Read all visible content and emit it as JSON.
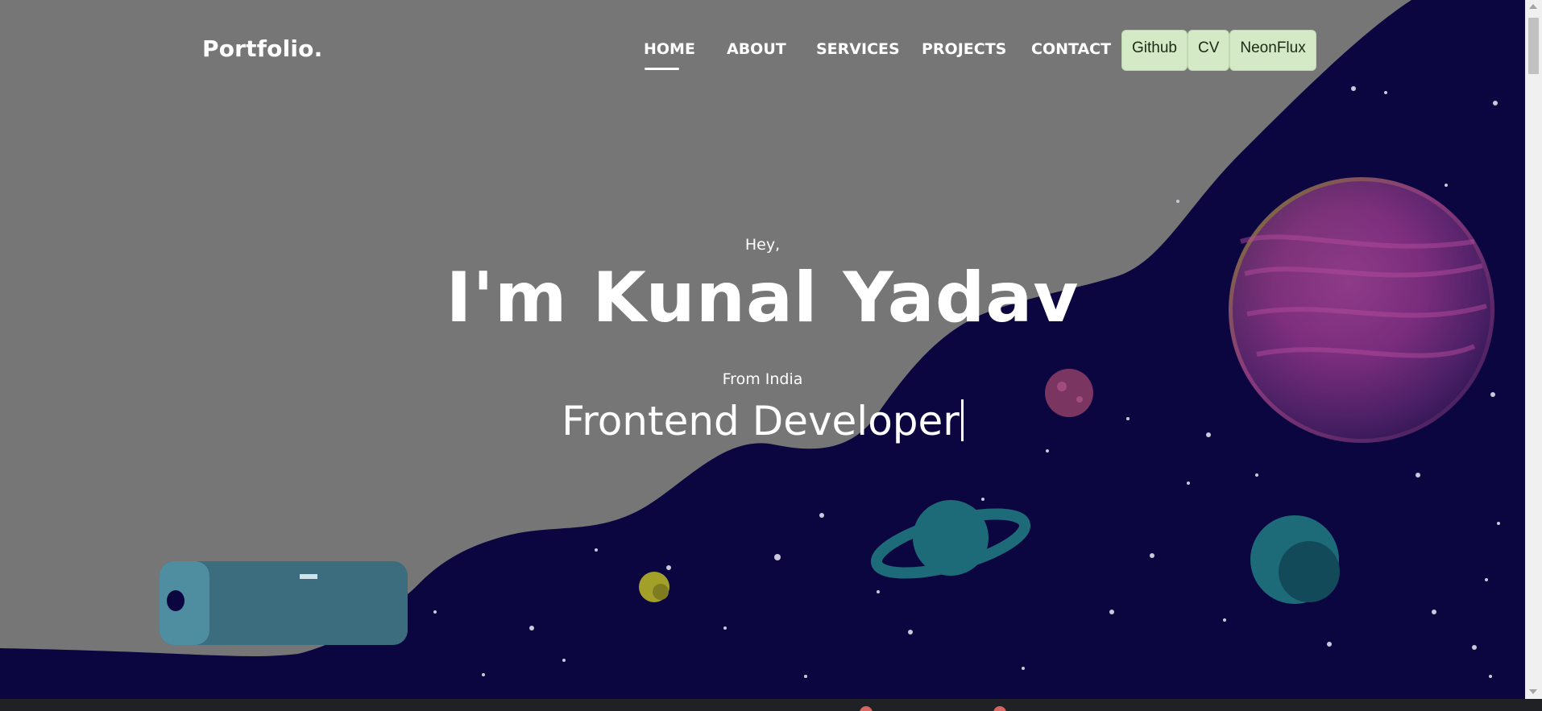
{
  "brand": "Portfolio.",
  "nav": {
    "items": [
      {
        "label": "HOME",
        "active": true
      },
      {
        "label": "ABOUT",
        "active": false
      },
      {
        "label": "SERVICES",
        "active": false
      },
      {
        "label": "PROJECTS",
        "active": false
      },
      {
        "label": "CONTACT",
        "active": false
      }
    ],
    "buttons": [
      {
        "label": "Github"
      },
      {
        "label": "CV"
      },
      {
        "label": "NeonFlux"
      }
    ]
  },
  "hero": {
    "greeting": "Hey,",
    "name": "I'm Kunal Yadav",
    "location": "From India",
    "role": "Frontend Developer"
  },
  "colors": {
    "overlay_gray": "#767676",
    "space": "#0b0540",
    "button_bg": "#d4e9c6",
    "text": "#ffffff"
  }
}
